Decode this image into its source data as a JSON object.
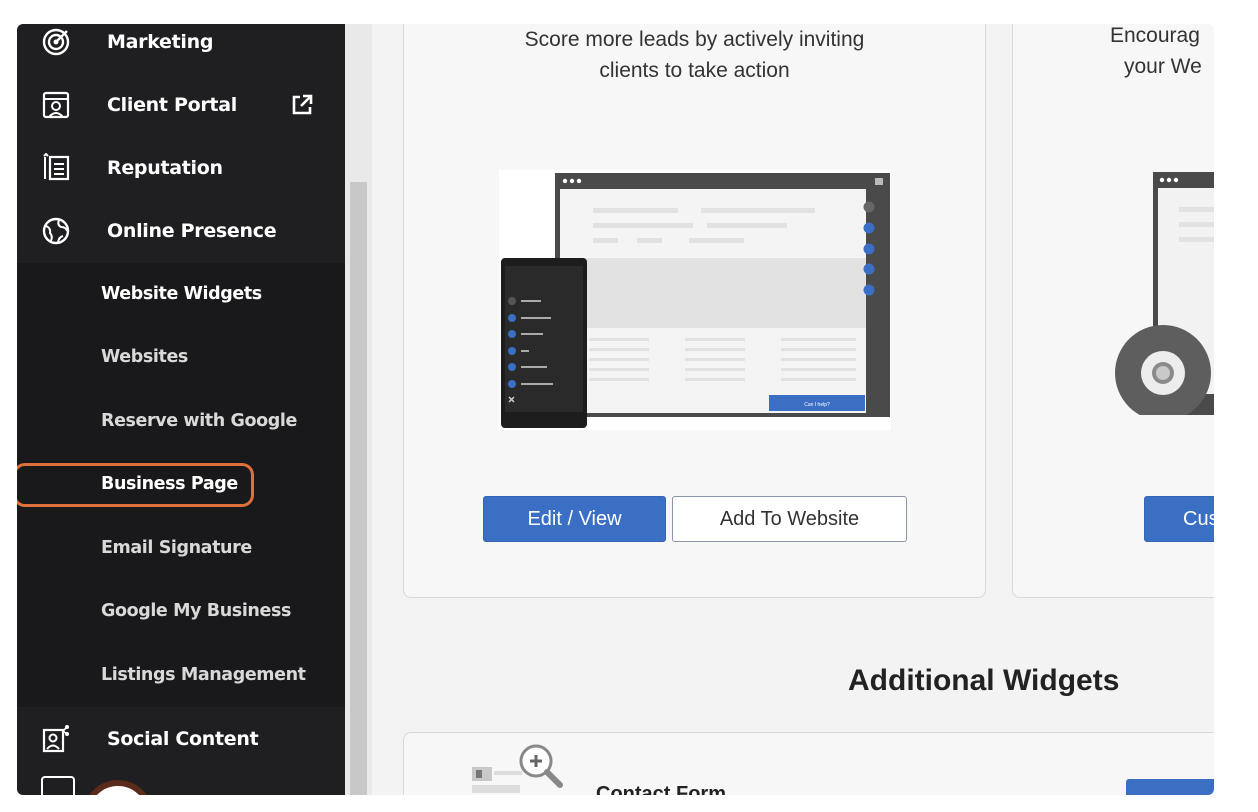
{
  "sidebar": {
    "items": [
      {
        "label": "Marketing",
        "icon": "marketing-target-icon"
      },
      {
        "label": "Client Portal",
        "icon": "client-portal-icon",
        "external_icon": "external-link-icon"
      },
      {
        "label": "Reputation",
        "icon": "reputation-list-icon"
      },
      {
        "label": "Online Presence",
        "icon": "globe-icon"
      },
      {
        "label": "Social Content",
        "icon": "social-content-icon"
      }
    ],
    "sub_items": [
      {
        "label": "Website Widgets"
      },
      {
        "label": "Websites"
      },
      {
        "label": "Reserve with Google"
      },
      {
        "label": "Business Page"
      },
      {
        "label": "Email Signature"
      },
      {
        "label": "Google My Business"
      },
      {
        "label": "Listings Management"
      }
    ],
    "active_sub_item": "Website Widgets",
    "highlighted_sub_item": "Business Page"
  },
  "cards": [
    {
      "description_line1": "Score more leads by actively inviting",
      "description_line2": "clients to take action",
      "primary_button": "Edit / View",
      "secondary_button": "Add To Website",
      "preview_button_text": "Can I help?"
    },
    {
      "description_line1": "Encourag",
      "description_line2": "your We",
      "primary_button": "Cus"
    }
  ],
  "additional": {
    "title": "Additional Widgets",
    "first_item_label": "Contact Form"
  },
  "colors": {
    "accent": "#3a6fc4",
    "highlight": "#e0703a",
    "sidebar_bg": "#1f1f22"
  }
}
